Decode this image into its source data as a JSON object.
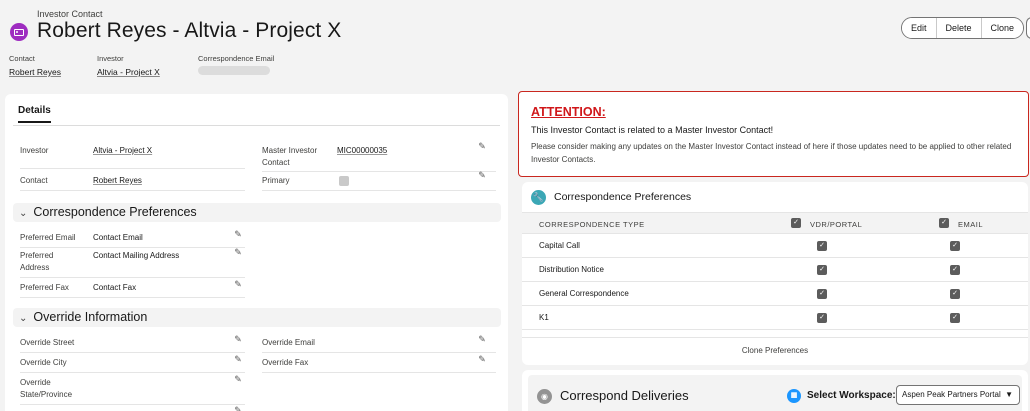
{
  "header": {
    "object_label": "Investor Contact",
    "title": "Robert Reyes - Altvia - Project X",
    "buttons": [
      "Edit",
      "Delete",
      "Clone"
    ],
    "fields": [
      {
        "label": "Contact",
        "value": "Robert Reyes"
      },
      {
        "label": "Investor",
        "value": "Altvia - Project X"
      },
      {
        "label": "Correspondence Email",
        "value": ""
      }
    ]
  },
  "details": {
    "tab": "Details",
    "rows": [
      {
        "label": "Investor",
        "value": "Altvia - Project X"
      },
      {
        "label": "Master Investor Contact",
        "value": "MIC00000035"
      },
      {
        "label": "Contact",
        "value": "Robert Reyes"
      },
      {
        "label": "Primary",
        "value": ""
      }
    ],
    "correspondence_section": "Correspondence Preferences",
    "correspondence_fields": [
      {
        "label": "Preferred Email",
        "value": "Contact Email"
      },
      {
        "label": "Preferred Address",
        "value": "Contact Mailing Address"
      },
      {
        "label": "Preferred Fax",
        "value": "Contact Fax"
      }
    ],
    "override_section": "Override Information",
    "override_fields": [
      {
        "label": "Override Street"
      },
      {
        "label": "Override Email"
      },
      {
        "label": "Override City"
      },
      {
        "label": "Override Fax"
      },
      {
        "label": "Override State/Province"
      }
    ]
  },
  "attention": {
    "title": "ATTENTION:",
    "line1": "This Investor Contact is related to a Master Investor Contact!",
    "line2": "Please consider making any updates on the Master Investor Contact instead of here if those updates need to be applied to other related Investor Contacts."
  },
  "prefs": {
    "title": "Correspondence Preferences",
    "columns": [
      "CORRESPONDENCE TYPE",
      "VDR/PORTAL",
      "EMAIL"
    ],
    "rows": [
      "Capital Call",
      "Distribution Notice",
      "General Correspondence",
      "K1"
    ],
    "clone_label": "Clone Preferences"
  },
  "deliveries": {
    "title": "Correspond Deliveries",
    "workspace_label": "Select Workspace:",
    "workspace_value": "Aspen Peak Partners Portal"
  }
}
